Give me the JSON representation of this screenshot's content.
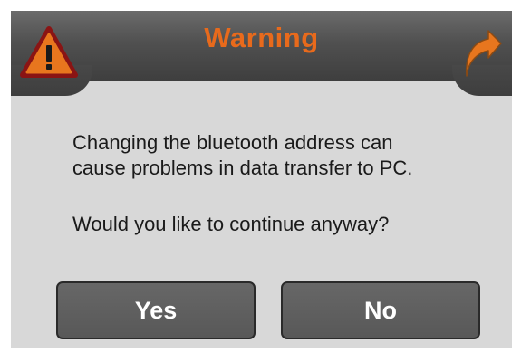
{
  "dialog": {
    "title": "Warning",
    "message_line1": "Changing the bluetooth address can",
    "message_line2": "cause problems in data transfer to PC.",
    "question": "Would you like to continue anyway?",
    "yes_label": "Yes",
    "no_label": "No",
    "title_color": "#e86a1c",
    "icons": {
      "left": "warning-triangle-icon",
      "right": "back-arrow-icon"
    }
  }
}
